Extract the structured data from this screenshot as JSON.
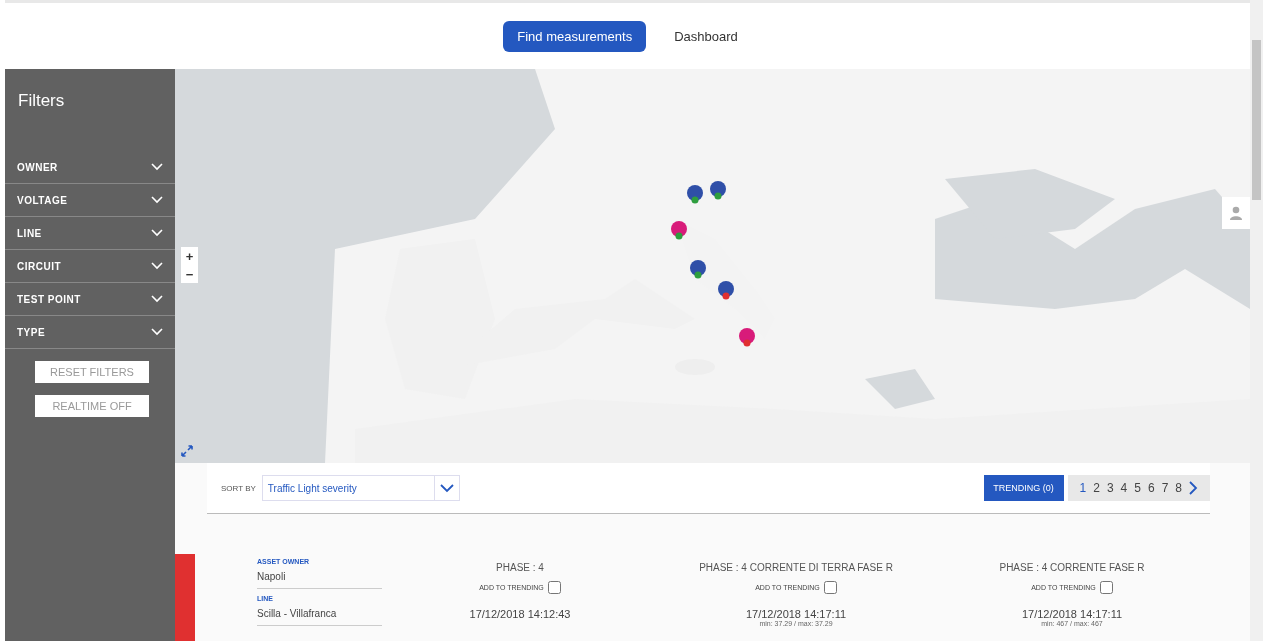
{
  "nav": [
    {
      "label": "Find measurements",
      "selected": true
    },
    {
      "label": "Dashboard",
      "selected": false
    }
  ],
  "filters": {
    "title": "Filters",
    "items": [
      {
        "label": "OWNER",
        "expanded": false
      },
      {
        "label": "VOLTAGE",
        "expanded": false
      },
      {
        "label": "LINE",
        "expanded": false
      },
      {
        "label": "CIRCUIT",
        "expanded": false
      },
      {
        "label": "TEST POINT",
        "expanded": false
      },
      {
        "label": "TYPE",
        "expanded": false
      }
    ],
    "buttons": [
      "RESET FILTERS",
      "REALTIME OFF"
    ]
  },
  "map": {
    "kind": "picture",
    "zoom_in": "+",
    "zoom_out": "−"
  },
  "sort": {
    "label": "SORT BY",
    "value": "Traffic Light severity"
  },
  "trending_button": "TRENDING (0)",
  "pages": [
    {
      "label": "1",
      "selected": true
    },
    {
      "label": "2",
      "selected": false
    },
    {
      "label": "3",
      "selected": false
    },
    {
      "label": "4",
      "selected": false
    },
    {
      "label": "5",
      "selected": false
    },
    {
      "label": "6",
      "selected": false
    },
    {
      "label": "7",
      "selected": false
    },
    {
      "label": "8",
      "selected": false
    }
  ],
  "result": {
    "color": "#e03030",
    "info": [
      {
        "label": "ASSET OWNER",
        "value": "Napoli"
      },
      {
        "label": "LINE",
        "value": "Scilla - Villafranca"
      }
    ],
    "measurements": [
      {
        "phase": "PHASE : 4",
        "trend_label": "ADD TO TRENDING",
        "checked": false,
        "time": "17/12/2018 14:12:43"
      },
      {
        "phase": "PHASE : 4 CORRENTE DI TERRA FASE R",
        "trend_label": "ADD TO TRENDING",
        "checked": false,
        "time": "17/12/2018 14:17:11",
        "range": "min: 37.29 / max: 37.29"
      },
      {
        "phase": "PHASE : 4 CORRENTE FASE R",
        "trend_label": "ADD TO TRENDING",
        "checked": false,
        "time": "17/12/2018 14:17:11",
        "range": "min: 467 / max: 467"
      }
    ]
  }
}
